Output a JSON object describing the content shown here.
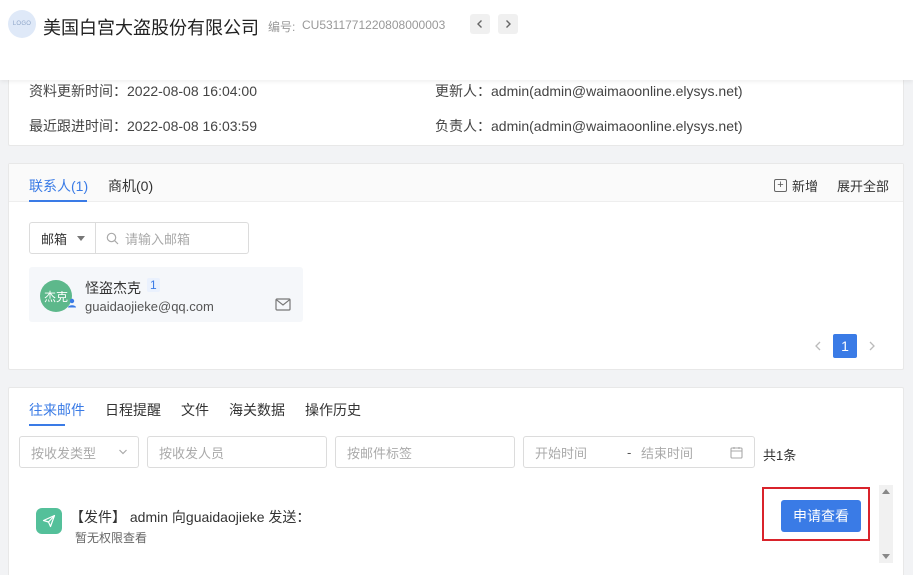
{
  "header": {
    "logo_text": "LOGO",
    "company_name": "美国白宫大盗股份有限公司",
    "code_label": "编号:",
    "code_value": "CU5311771220808000003",
    "prev_icon": "chevron-left-icon",
    "next_icon": "chevron-right-icon"
  },
  "info": {
    "updated_time": "资料更新时间：2022-08-08 16:04:00",
    "updater": "更新人：admin(admin@waimaoonline.elysys.net)",
    "followup_time": "最近跟进时间：2022-08-08 16:03:59",
    "owner": "负责人：admin(admin@waimaoonline.elysys.net)"
  },
  "contacts": {
    "tabs": [
      {
        "label": "联系人(1)",
        "active": true
      },
      {
        "label": "商机(0)",
        "active": false
      }
    ],
    "add_label": "新增",
    "expand_label": "展开全部",
    "filter": {
      "select_value": "邮箱",
      "placeholder": "请输入邮箱"
    },
    "items": [
      {
        "avatar_text": "杰克",
        "name": "怪盗杰克",
        "count": "1",
        "email": "guaidaojieke@qq.com"
      }
    ],
    "pager": {
      "current": "1"
    }
  },
  "activity": {
    "tabs": [
      {
        "label": "往来邮件",
        "active": true
      },
      {
        "label": "日程提醒",
        "active": false
      },
      {
        "label": "文件",
        "active": false
      },
      {
        "label": "海关数据",
        "active": false
      },
      {
        "label": "操作历史",
        "active": false
      }
    ],
    "filters": {
      "type_placeholder": "按收发类型",
      "person_placeholder": "按收发人员",
      "tag_placeholder": "按邮件标签",
      "start_placeholder": "开始时间",
      "date_separator": "-",
      "end_placeholder": "结束时间"
    },
    "total": "共1条",
    "records": [
      {
        "title": "【发件】 admin 向guaidaojieke 发送：",
        "subtitle": "暂无权限查看",
        "action_label": "申请查看"
      }
    ]
  },
  "colors": {
    "accent": "#3a7be6",
    "avatar": "#5db88b",
    "send_icon": "#54c09a",
    "highlight": "#d9232b"
  }
}
